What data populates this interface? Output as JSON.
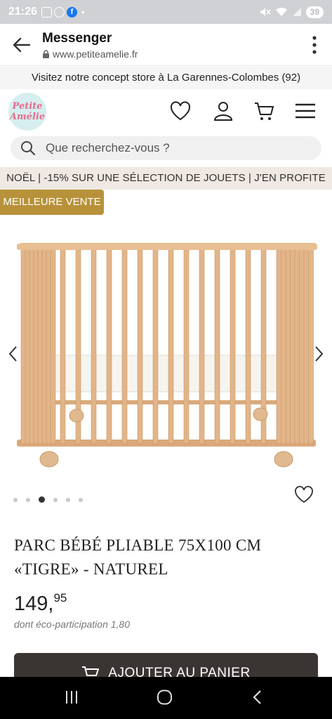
{
  "status_bar": {
    "time": "21:26",
    "battery": "39"
  },
  "browser": {
    "title": "Messenger",
    "url": "www.petiteamelie.fr"
  },
  "promo_top": "Visitez notre concept store à La Garennes-Colombes (92)",
  "logo": {
    "line1": "Petite",
    "line2": "Amélie"
  },
  "search": {
    "placeholder": "Que recherchez-vous ?"
  },
  "noel_banner": "NOËL | -15% SUR UNE SÉLECTION DE JOUETS | J'EN PROFITE",
  "badge": "MEILLEURE VENTE",
  "carousel": {
    "total": 6,
    "active": 3
  },
  "product": {
    "title": "PARC BÉBÉ PLIABLE 75X100 CM «TIGRE» - NATUREL",
    "price_int": "149,",
    "price_dec": "95",
    "eco": "dont éco-participation 1,80"
  },
  "cart_button": "AJOUTER AU PANIER",
  "colors": {
    "badge": "#b8923a",
    "cart": "#3a3533",
    "noel_bg": "#efe8e3"
  }
}
